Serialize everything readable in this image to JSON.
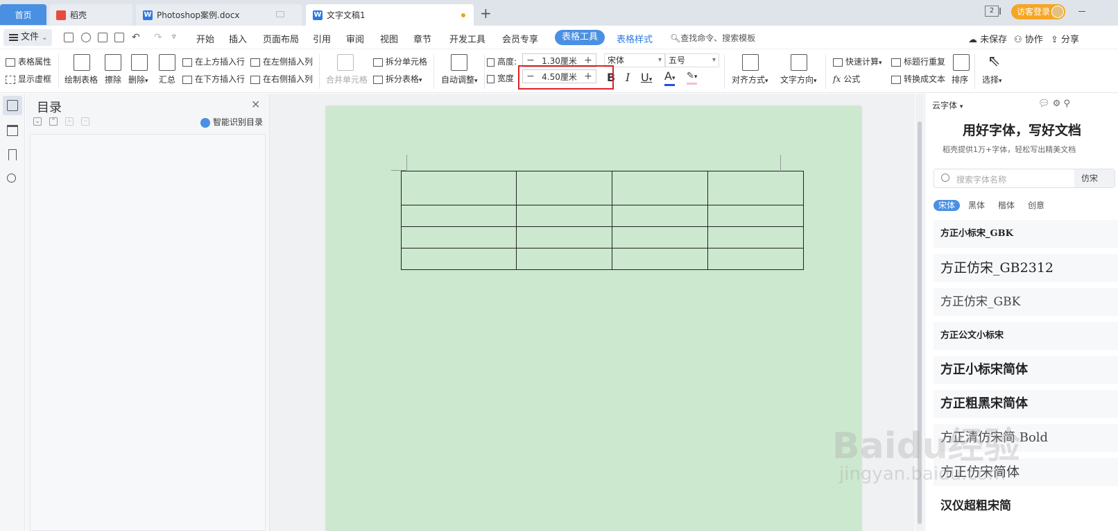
{
  "tabs": {
    "home": "首页",
    "daoke": "稻壳",
    "ps_doc": "Photoshop案例.docx",
    "active_doc": "文字文稿1",
    "new_tab": "+"
  },
  "topbar": {
    "badge": "2",
    "guest_login": "访客登录"
  },
  "menu": {
    "file": "文件",
    "items": [
      "开始",
      "插入",
      "页面布局",
      "引用",
      "审阅",
      "视图",
      "章节",
      "开发工具",
      "会员专享"
    ],
    "active": "表格工具",
    "table_style": "表格样式",
    "search": "查找命令、搜索模板",
    "unsaved": "未保存",
    "collab": "协作",
    "share": "分享"
  },
  "ribbon": {
    "table_props": "表格属性",
    "show_grid": "显示虚框",
    "draw_table": "绘制表格",
    "erase": "擦除",
    "delete": "删除",
    "summary": "汇总",
    "insert_above": "在上方插入行",
    "insert_below": "在下方插入行",
    "insert_left": "在左侧插入列",
    "insert_right": "在右侧插入列",
    "merge": "合并单元格",
    "split_cell": "拆分单元格",
    "split_table": "拆分表格",
    "auto_adjust": "自动调整",
    "height_label": "高度:",
    "height_value": "1.30厘米",
    "width_label": "宽度",
    "width_value": "4.50厘米",
    "font_name": "宋体",
    "font_size": "五号",
    "align": "对齐方式",
    "text_dir": "文字方向",
    "quick_calc": "快速计算",
    "formula": "公式",
    "title_repeat": "标题行重复",
    "to_text": "转换成文本",
    "sort": "排序",
    "select": "选择"
  },
  "toc": {
    "title": "目录",
    "smart": "智能识别目录"
  },
  "fontpanel": {
    "cloud": "云字体",
    "headline": "用好字体，写好文档",
    "subline": "稻壳提供1万+字体，轻松写出精美文档",
    "search_placeholder": "搜索字体名称",
    "search_tag": "仿宋",
    "categories": [
      "宋体",
      "黑体",
      "楷体",
      "创意"
    ],
    "fonts": [
      "方正小标宋_GBK",
      "方正仿宋_GB2312",
      "方正仿宋_GBK",
      "方正公文小标宋",
      "方正小标宋简体",
      "方正粗黑宋简体",
      "方正清仿宋简 Bold",
      "方正仿宋简体",
      "汉仪超粗宋简"
    ]
  },
  "colors": {
    "accent": "#4a90e2",
    "page_bg": "#cce8cf",
    "highlight": "#e02020"
  }
}
